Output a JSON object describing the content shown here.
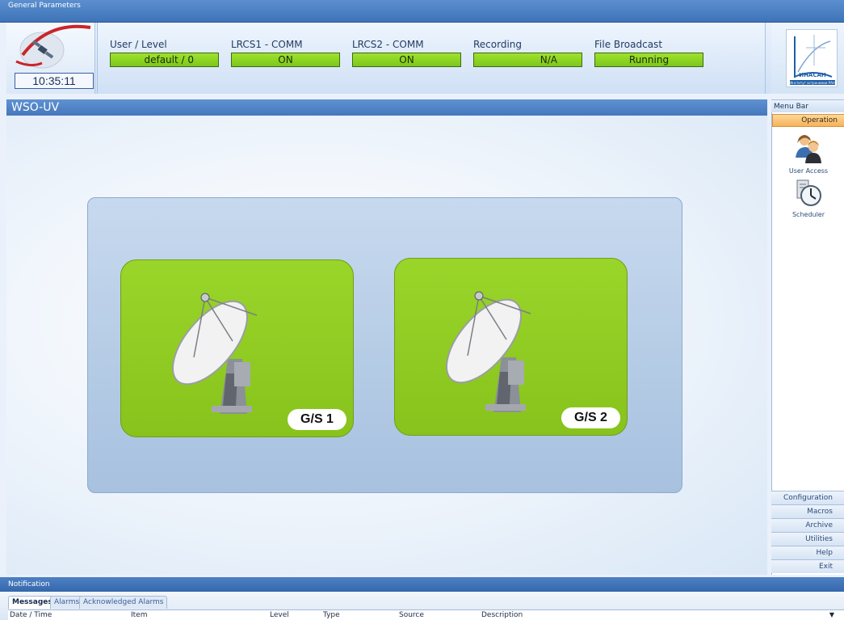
{
  "general_parameters": {
    "title": "General Parameters",
    "clock": "10:35:11",
    "params": [
      {
        "label": "User / Level",
        "value": "default / 0"
      },
      {
        "label": "LRCS1 - COMM",
        "value": "ON"
      },
      {
        "label": "LRCS2 - COMM",
        "value": "ON"
      },
      {
        "label": "Recording",
        "value": "N/A"
      },
      {
        "label": "File Broadcast",
        "value": "Running"
      }
    ],
    "org_logo_text": "ИНАСАН",
    "org_logo_subtext": "Институт астрономии РАН"
  },
  "main": {
    "title": "WSO-UV",
    "stations": [
      {
        "label": "G/S 1"
      },
      {
        "label": "G/S 2"
      }
    ]
  },
  "menu_bar": {
    "title": "Menu Bar",
    "operation_label": "Operation",
    "operation_items": [
      {
        "label": "User Access",
        "icon": "users-icon"
      },
      {
        "label": "Scheduler",
        "icon": "clock-icon"
      }
    ],
    "bottom_items": [
      "Configuration",
      "Macros",
      "Archive",
      "Utilities",
      "Help",
      "Exit"
    ]
  },
  "notification": {
    "title": "Notification",
    "tabs": [
      "Messages",
      "Alarms",
      "Acknowledged Alarms"
    ],
    "columns": [
      "Date / Time",
      "Item",
      "Level",
      "Type",
      "Source",
      "Description"
    ]
  },
  "colors": {
    "status_green": "#8fd624",
    "header_blue": "#4577bb",
    "menu_active_orange": "#f6b35a",
    "card_green": "#8ecb22"
  }
}
